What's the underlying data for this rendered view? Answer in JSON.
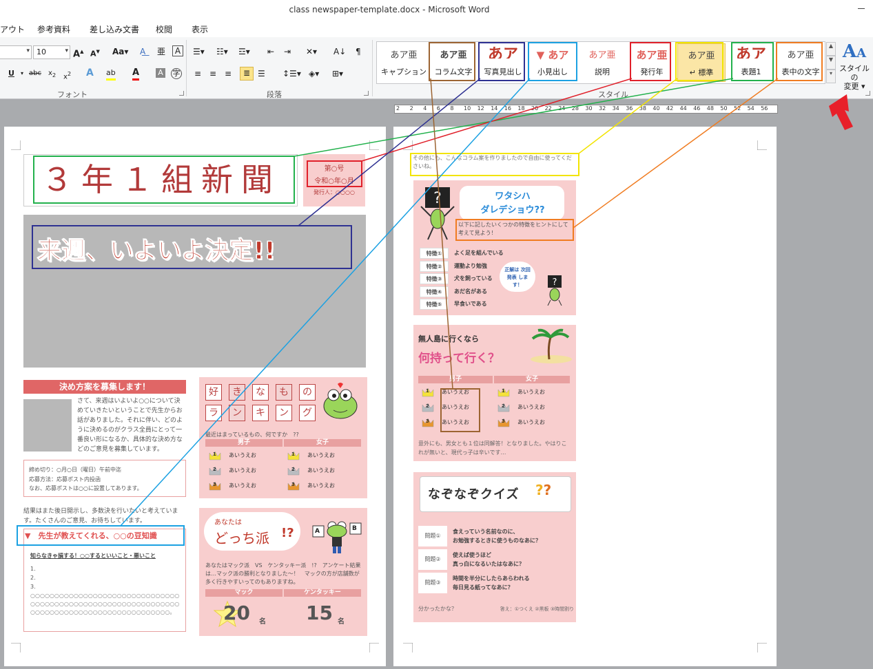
{
  "window": {
    "title": "class newspaper-template.docx  -  Microsoft Word"
  },
  "tabs": [
    "アウト",
    "参考資料",
    "差し込み文書",
    "校閲",
    "表示"
  ],
  "ribbon": {
    "font_size": "10",
    "font_group_label": "フォント",
    "paragraph_group_label": "段落",
    "style_group_label": "スタイル",
    "change_styles_label_1": "スタイルの",
    "change_styles_label_2": "変更",
    "styles": [
      {
        "sample": "あア亜",
        "name": "キャプション"
      },
      {
        "sample": "あア亜",
        "name": "コラム文字"
      },
      {
        "sample": "あア",
        "name": "写真見出し"
      },
      {
        "sample": "あア",
        "name": "小見出し"
      },
      {
        "sample": "あア亜",
        "name": "説明"
      },
      {
        "sample": "あア亜",
        "name": "発行年"
      },
      {
        "sample": "あア亜",
        "name": "↵ 標準"
      },
      {
        "sample": "あア",
        "name": "表題1"
      },
      {
        "sample": "あア亜",
        "name": "表中の文字"
      }
    ]
  },
  "ruler": {
    "ticks": [
      "2",
      "2",
      "4",
      "6",
      "8",
      "10",
      "12",
      "14",
      "16",
      "18",
      "20",
      "22",
      "24",
      "28",
      "30",
      "32",
      "34",
      "36",
      "38",
      "40",
      "42",
      "44",
      "46",
      "48",
      "50",
      "52",
      "54",
      "56"
    ]
  },
  "page1": {
    "newspaper_title": "３年１組新聞",
    "issue_no": "第○号",
    "issue_date": "令和○年○月",
    "publisher": "発行人：○○○○",
    "headline": "来週、いよいよ決定!!",
    "recruit_title": "決め方案を募集します！",
    "recruit_body": "さて、来週はいよいよ○○について決めていきたいということで先生からお話がありました。それに伴い、どのように決めるのがクラス全員にとって一番良い形になるか、具体的な決め方などのご意見を募集しています。",
    "deadline": "締め切り：○月○日（曜日）午前中迄",
    "method": "応募方法：応募ポスト内投函",
    "note": "なお、応募ポストは○○に設置してあります。",
    "result_text": "結果はまた後日開示し、多数決を行いたいと考えています。たくさんのご意見、お待ちしています。",
    "trivia_title": "▼　先生が教えてくれる、○○の豆知識",
    "trivia_sub": "知らなきゃ損する！○○するといいこと・悪いこと",
    "trivia_items": [
      "1.",
      "2.",
      "3."
    ],
    "trivia_filler": "○○○○○○○○○○○○○○○○○○○○○○○○○○○○○○○○○○○○○○○○○○○○○○○○○○○○○○○○○○○○○○○○○○○○○○○○○○○○○○○○○○○○○○○○○○○。",
    "ranking_chars": [
      "好",
      "き",
      "な",
      "も",
      "の",
      "ラ",
      "ン",
      "キ",
      "ン",
      "グ"
    ],
    "ranking_caption": "最近はまっているもの、何ですか　??",
    "boys": "男子",
    "girls": "女子",
    "rank_entry": "あいうえお",
    "ranks": [
      "1",
      "2",
      "3"
    ],
    "poll_small": "あなたは",
    "poll_big": "どっち派",
    "poll_mark": "!?",
    "poll_ab": [
      "A",
      "B"
    ],
    "poll_text": "あなたはマック派　VS　ケンタッキー派　!?　アンケート結果は…マック派の勝利となりました～！　マックの方が店舗数が多く行きやすいってのもありますね。",
    "mac": "マック",
    "kfc": "ケンタッキー",
    "mac_count": "20",
    "kfc_count": "15",
    "unit": "名"
  },
  "page2": {
    "intro": "その他にも、こんなコラム案を作りましたので自由に使ってくださいね。",
    "who_line1": "ワタシハ",
    "who_line2": "ダレデショウ??",
    "hint": "以下に記したいくつかの特徴をヒントにして考えて見よう！",
    "features": [
      {
        "label": "特徴①",
        "text": "よく足を組んでいる"
      },
      {
        "label": "特徴②",
        "text": "運動より勉強"
      },
      {
        "label": "特徴③",
        "text": "犬を飼っている"
      },
      {
        "label": "特徴④",
        "text": "あだ名がある"
      },
      {
        "label": "特徴⑤",
        "text": "早食いである"
      }
    ],
    "answer_bubble": "正解は 次回発表 します！",
    "island_title": "無人島に行くなら",
    "island_sub": "何持って行く？",
    "island_text": "意外にも、男女とも１位は同解答！となりました。やはりこれが無いと、現代っ子は辛いです…",
    "quiz_title": "なぞなぞクイズ",
    "quiz": [
      {
        "label": "問題①",
        "q1": "食えっていう名前なのに、",
        "q2": "お勉強するときに使うものなあに？"
      },
      {
        "label": "問題②",
        "q1": "使えば使うほど",
        "q2": "真っ白になるいたはなあに？"
      },
      {
        "label": "問題③",
        "q1": "時間を半分にしたらあらわれる",
        "q2": "毎日見る紙ってなあに？"
      }
    ],
    "quiz_footer": "分かったかな？",
    "quiz_answers": "答え：①つくえ ②黒板 ③時間割り"
  },
  "colors": {
    "pink_panel": "#f8cece",
    "title_red": "#b23a3a",
    "annot_green": "#22b14c",
    "annot_red": "#e0202a",
    "annot_blue": "#2e3192",
    "annot_cyan": "#1ba1e2",
    "annot_yellow": "#f2e400",
    "annot_orange": "#f07c21",
    "annot_brown": "#9c6432",
    "arrow_red": "#e8202a"
  }
}
